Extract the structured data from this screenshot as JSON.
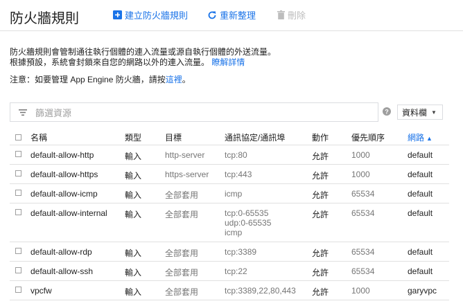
{
  "header": {
    "title": "防火牆規則",
    "create_label": "建立防火牆規則",
    "refresh_label": "重新整理",
    "delete_label": "刪除"
  },
  "info": {
    "line1": "防火牆規則會管制通往執行個體的連入流量或源自執行個體的外送流量。",
    "line2": "根據預設，系統會封鎖來自您的網路以外的連入流量。",
    "learn_more": "瞭解詳情",
    "note_prefix": "注意：如要管理 App Engine 防火牆，請按",
    "note_link": "這裡",
    "note_suffix": "。"
  },
  "filter": {
    "placeholder": "篩選資源"
  },
  "columns_button": "資料欄",
  "colors": {
    "accent": "#1a73e8",
    "muted": "#757575"
  },
  "table": {
    "headers": {
      "name": "名稱",
      "type": "類型",
      "target": "目標",
      "protocol": "通訊協定/通訊埠",
      "action": "動作",
      "priority": "優先順序",
      "network": "網路"
    },
    "network_sort": "ascending",
    "rows": [
      {
        "name": "default-allow-http",
        "type": "輸入",
        "target": "http-server",
        "protocol": [
          "tcp:80"
        ],
        "action": "允許",
        "priority": "1000",
        "network": "default"
      },
      {
        "name": "default-allow-https",
        "type": "輸入",
        "target": "https-server",
        "protocol": [
          "tcp:443"
        ],
        "action": "允許",
        "priority": "1000",
        "network": "default"
      },
      {
        "name": "default-allow-icmp",
        "type": "輸入",
        "target": "全部套用",
        "protocol": [
          "icmp"
        ],
        "action": "允許",
        "priority": "65534",
        "network": "default"
      },
      {
        "name": "default-allow-internal",
        "type": "輸入",
        "target": "全部套用",
        "protocol": [
          "tcp:0-65535",
          "udp:0-65535",
          "icmp"
        ],
        "action": "允許",
        "priority": "65534",
        "network": "default"
      },
      {
        "name": "default-allow-rdp",
        "type": "輸入",
        "target": "全部套用",
        "protocol": [
          "tcp:3389"
        ],
        "action": "允許",
        "priority": "65534",
        "network": "default"
      },
      {
        "name": "default-allow-ssh",
        "type": "輸入",
        "target": "全部套用",
        "protocol": [
          "tcp:22"
        ],
        "action": "允許",
        "priority": "65534",
        "network": "default"
      },
      {
        "name": "vpcfw",
        "type": "輸入",
        "target": "全部套用",
        "protocol": [
          "tcp:3389,22,80,443"
        ],
        "action": "允許",
        "priority": "1000",
        "network": "garyvpc"
      }
    ]
  }
}
